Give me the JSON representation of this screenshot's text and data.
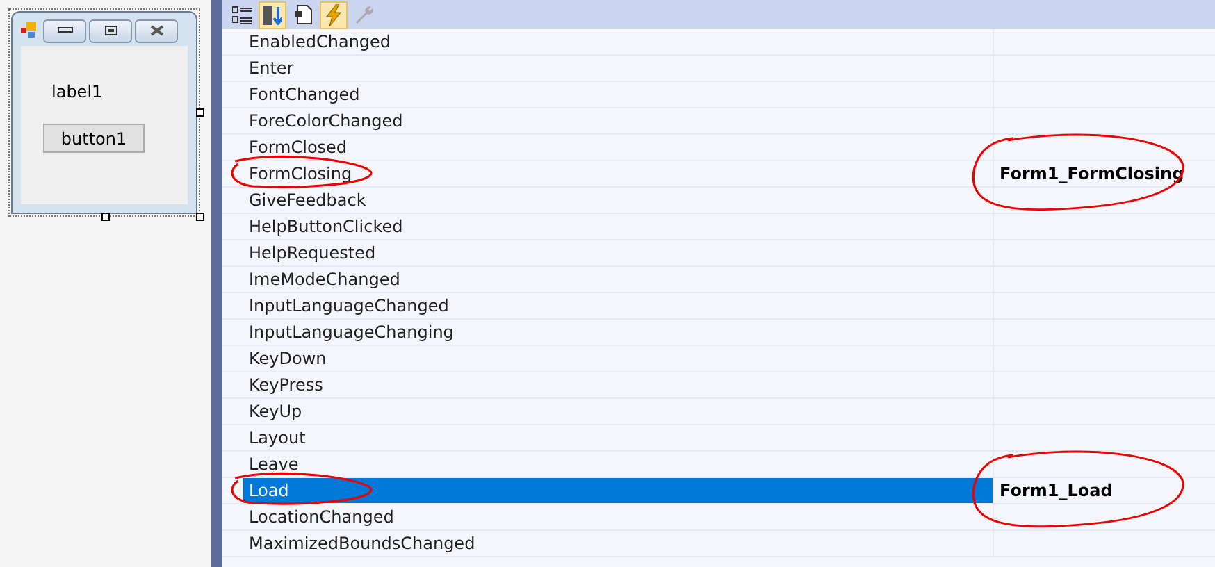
{
  "designer": {
    "label": "label1",
    "button": "button1"
  },
  "toolbar": [
    {
      "kind": "categorized",
      "selected": false
    },
    {
      "kind": "alphabetical",
      "selected": true
    },
    {
      "kind": "properties",
      "selected": false
    },
    {
      "kind": "events",
      "selected": true
    },
    {
      "kind": "property-pages",
      "selected": false,
      "disabled": true
    }
  ],
  "events": [
    {
      "name": "EnabledChanged",
      "selected": false,
      "name_circled": false,
      "handler_circled": false
    },
    {
      "name": "Enter",
      "selected": false,
      "name_circled": false,
      "handler_circled": false
    },
    {
      "name": "FontChanged",
      "selected": false,
      "name_circled": false,
      "handler_circled": false
    },
    {
      "name": "ForeColorChanged",
      "selected": false,
      "name_circled": false,
      "handler_circled": false
    },
    {
      "name": "FormClosed",
      "selected": false,
      "name_circled": false,
      "handler_circled": false
    },
    {
      "name": "FormClosing",
      "handler": "Form1_FormClosing",
      "selected": false,
      "name_circled": true,
      "handler_circled": true
    },
    {
      "name": "GiveFeedback",
      "selected": false,
      "name_circled": false,
      "handler_circled": false
    },
    {
      "name": "HelpButtonClicked",
      "selected": false,
      "name_circled": false,
      "handler_circled": false
    },
    {
      "name": "HelpRequested",
      "selected": false,
      "name_circled": false,
      "handler_circled": false
    },
    {
      "name": "ImeModeChanged",
      "selected": false,
      "name_circled": false,
      "handler_circled": false
    },
    {
      "name": "InputLanguageChanged",
      "selected": false,
      "name_circled": false,
      "handler_circled": false
    },
    {
      "name": "InputLanguageChanging",
      "selected": false,
      "name_circled": false,
      "handler_circled": false
    },
    {
      "name": "KeyDown",
      "selected": false,
      "name_circled": false,
      "handler_circled": false
    },
    {
      "name": "KeyPress",
      "selected": false,
      "name_circled": false,
      "handler_circled": false
    },
    {
      "name": "KeyUp",
      "selected": false,
      "name_circled": false,
      "handler_circled": false
    },
    {
      "name": "Layout",
      "selected": false,
      "name_circled": false,
      "handler_circled": false
    },
    {
      "name": "Leave",
      "selected": false,
      "name_circled": false,
      "handler_circled": false
    },
    {
      "name": "Load",
      "handler": "Form1_Load",
      "selected": true,
      "name_circled": true,
      "handler_circled": true
    },
    {
      "name": "LocationChanged",
      "selected": false,
      "name_circled": false,
      "handler_circled": false
    },
    {
      "name": "MaximizedBoundsChanged",
      "selected": false,
      "name_circled": false,
      "handler_circled": false
    }
  ]
}
